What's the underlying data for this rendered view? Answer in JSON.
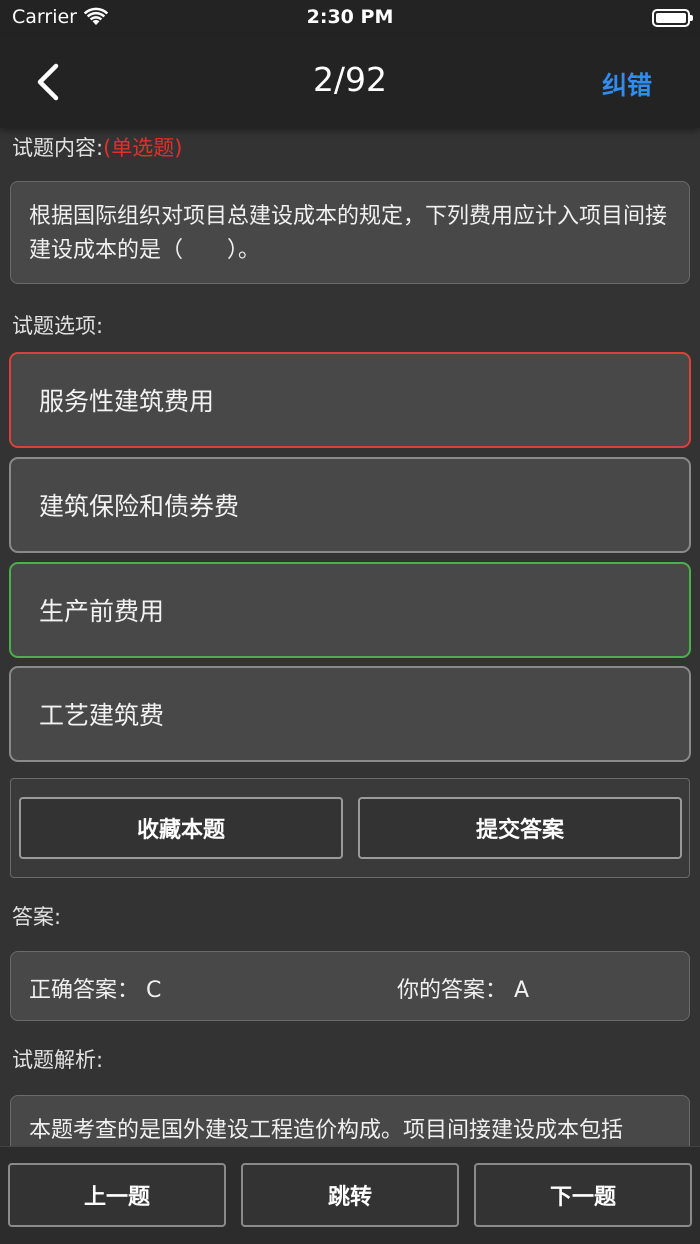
{
  "status_bar": {
    "carrier": "Carrier",
    "time": "2:30 PM",
    "wifi_icon": "wifi-icon",
    "battery_icon": "battery-icon"
  },
  "nav": {
    "back_icon": "chevron-left-icon",
    "title": "2/92",
    "correct_label": "纠错",
    "accent_color": "#2f8cf0"
  },
  "question": {
    "content_label": "试题内容:",
    "type_tag": "(单选题)",
    "text": "根据国际组织对项目总建设成本的规定，下列费用应计入项目间接建设成本的是（　　）。",
    "options_label": "试题选项:",
    "options": [
      {
        "label": "服务性建筑费用",
        "state": "wrong"
      },
      {
        "label": "建筑保险和债券费",
        "state": "normal"
      },
      {
        "label": "生产前费用",
        "state": "correct"
      },
      {
        "label": "工艺建筑费",
        "state": "normal"
      }
    ]
  },
  "actions": {
    "favorite_label": "收藏本题",
    "submit_label": "提交答案"
  },
  "answer": {
    "label": "答案:",
    "correct_prefix": "正确答案：",
    "correct_value": "C",
    "mine_prefix": "你的答案：",
    "mine_value": "A"
  },
  "analysis": {
    "label": "试题解析:",
    "text": "本题考查的是国外建设工程造价构成。项目间接建设成本包括"
  },
  "bottom_nav": {
    "prev_label": "上一题",
    "jump_label": "跳转",
    "next_label": "下一题"
  },
  "colors": {
    "wrong_border": "#d9423a",
    "correct_border": "#4cae4c",
    "tag_red": "#e0302a"
  }
}
